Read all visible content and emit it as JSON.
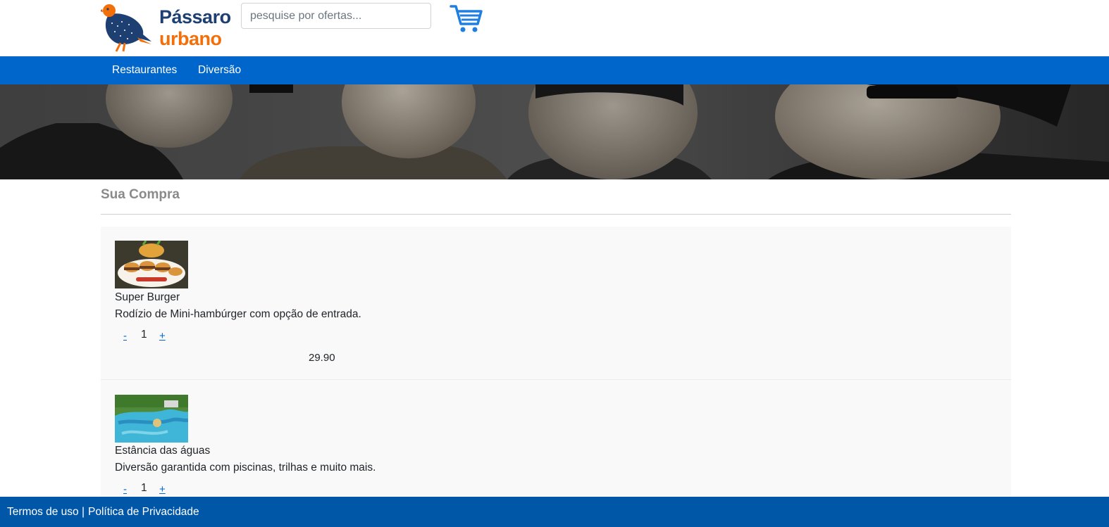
{
  "brand": {
    "name_line1": "Pássaro",
    "name_line2": "urbano",
    "primary_color": "#1d3f72",
    "accent_color": "#f26f0a"
  },
  "search": {
    "placeholder": "pesquise por ofertas..."
  },
  "header": {
    "cart_icon": "shopping-cart-icon"
  },
  "nav": {
    "items": [
      {
        "label": "Restaurantes"
      },
      {
        "label": "Diversão"
      }
    ],
    "background": "#0066cc"
  },
  "page": {
    "title": "Sua Compra"
  },
  "cart": {
    "items": [
      {
        "title": "Super Burger",
        "description": "Rodízio de Mini-hambúrger com opção de entrada.",
        "minus_label": "-",
        "quantity": "1",
        "plus_label": "+",
        "price": "29.90"
      },
      {
        "title": "Estância das águas",
        "description": "Diversão garantida com piscinas, trilhas e muito mais.",
        "minus_label": "-",
        "quantity": "1",
        "plus_label": "+"
      }
    ]
  },
  "footer": {
    "terms": "Termos de uso",
    "separator": "|",
    "privacy": "Política de Privacidade",
    "background": "#0057a8"
  }
}
